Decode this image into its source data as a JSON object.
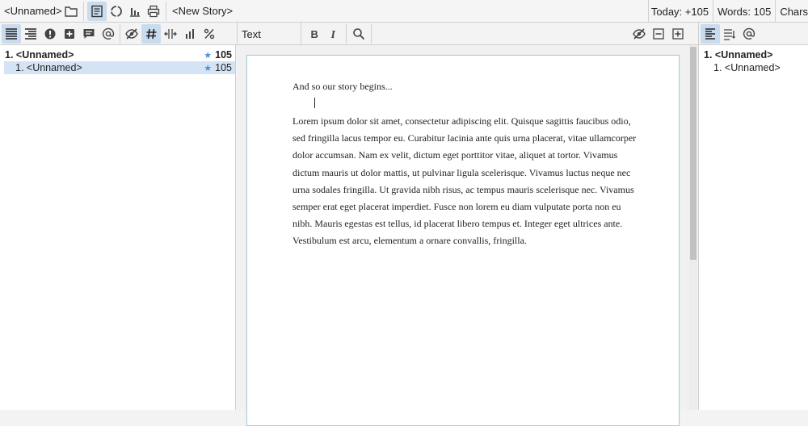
{
  "topbar": {
    "project_name": "<Unnamed>",
    "story_name": "<New Story>",
    "today_label": "Today: +105",
    "words_label": "Words: 105",
    "chars_label": "Chars"
  },
  "toolbar2": {
    "style_value": "Text"
  },
  "outline_left": {
    "items": [
      {
        "label": "1. <Unnamed>",
        "count": "105"
      },
      {
        "label": "1. <Unnamed>",
        "count": "105"
      }
    ]
  },
  "document": {
    "intro": "And so our story begins...",
    "body": "Lorem ipsum dolor sit amet, consectetur adipiscing elit. Quisque sagittis faucibus odio, sed fringilla lacus tempor eu. Curabitur lacinia ante quis urna placerat, vitae ullamcorper dolor accumsan. Nam ex velit, dictum eget porttitor vitae, aliquet at tortor. Vivamus dictum mauris ut dolor mattis, ut pulvinar ligula scelerisque. Vivamus luctus neque nec urna sodales fringilla. Ut gravida nibh risus, ac tempus mauris scelerisque nec. Vivamus semper erat eget placerat imperdiet. Fusce non lorem eu diam vulputate porta non eu nibh. Mauris egestas est tellus, id placerat libero tempus et. Integer eget ultrices ante. Vestibulum est arcu, elementum a ornare convallis, fringilla."
  },
  "outline_right": {
    "items": [
      {
        "label": "1. <Unnamed>"
      },
      {
        "label": "1. <Unnamed>"
      }
    ]
  },
  "colors": {
    "active_button": "#c9dcee",
    "selected_row": "#d4e4f5",
    "star": "#4a90d9",
    "page_border": "#a9cfe0"
  }
}
